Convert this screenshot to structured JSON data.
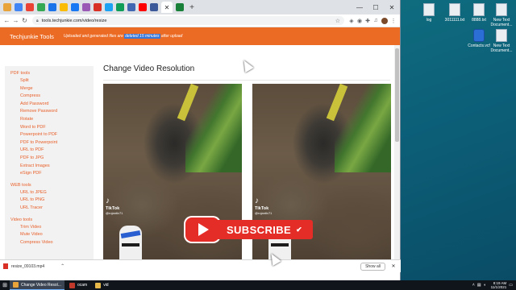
{
  "browser": {
    "url": "tools.techjunkie.com/video/resize",
    "window_controls": [
      "—",
      "☐",
      "✕"
    ]
  },
  "site": {
    "brand": "Techjunkie Tools",
    "notice_pre": "Uploaded and generated files are ",
    "notice_highlight": "deleted 15 minutes",
    "notice_post": " after upload"
  },
  "sidebar": {
    "pdf_title": "PDF tools",
    "pdf_links": [
      "Split",
      "Merge",
      "Compress",
      "Add Password",
      "Remove Password",
      "Rotate",
      "Word to PDF",
      "Powerpoint to PDF",
      "PDF to Powerpoint",
      "URL to PDF",
      "PDF to JPG",
      "Extract Images",
      "eSign PDF"
    ],
    "web_title": "WEB tools",
    "web_links": [
      "URL to JPEG",
      "URL to PNG",
      "URL Tracer"
    ],
    "video_title": "Video tools",
    "video_links": [
      "Trim Video",
      "Mute Video",
      "Compress Video"
    ]
  },
  "main": {
    "title": "Change Video Resolution",
    "video_left": {
      "app": "TikTok",
      "handle": "@rojantiv71"
    },
    "video_right": {
      "app": "TikTok",
      "handle": "@rojantiv71"
    }
  },
  "overlay": {
    "subscribe_label": "SUBSCRIBE"
  },
  "download": {
    "filename": "resize_09103.mp4",
    "show_all": "Show all"
  },
  "desktop_icons": [
    {
      "label": "log"
    },
    {
      "label": "3011111.txt"
    },
    {
      "label": "8888.txt"
    },
    {
      "label": "New Text Document...",
      "style": ""
    },
    {
      "label": "Contacts.vcf",
      "style": "blue"
    },
    {
      "label": "New Text Document...",
      "style": ""
    }
  ],
  "taskbar": {
    "items": [
      {
        "label": "Change Video Resol...",
        "color": "#e8a33a",
        "active": true
      },
      {
        "label": "ocam",
        "color": "#c0392b",
        "active": false
      },
      {
        "label": "vid",
        "color": "#e6b84a",
        "active": false
      }
    ],
    "time": "8:19 AM",
    "date": "11/1/2021"
  },
  "colors": {
    "header_orange": "#ec6b24",
    "link_orange": "#e8602a",
    "subscribe_red": "#e52d27"
  }
}
